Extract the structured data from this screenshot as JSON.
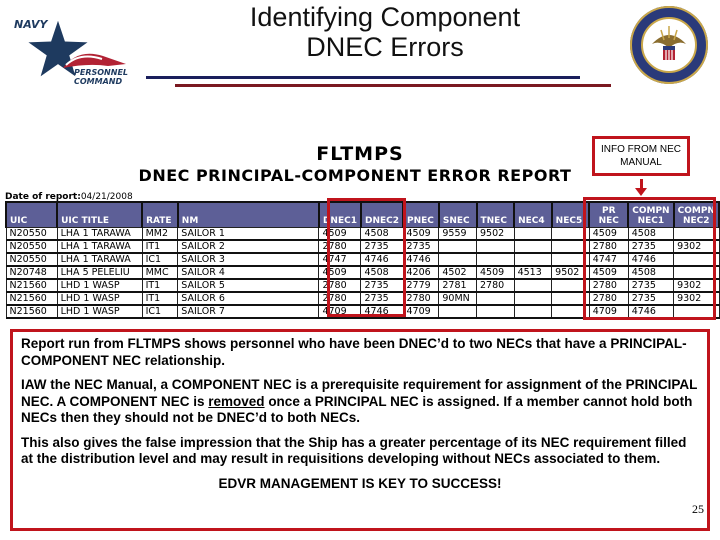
{
  "header": {
    "title_line1": "Identifying Component",
    "title_line2": "DNEC Errors",
    "left_logo": {
      "icon": "navy-personnel-command-logo-icon",
      "text_line1": "NAVY",
      "text_line2": "PERSONNEL",
      "text_line3": "COMMAND"
    },
    "right_logo": {
      "icon": "us-navy-seal-icon"
    }
  },
  "report": {
    "system": "FLTMPS",
    "title": "DNEC PRINCIPAL-COMPONENT ERROR REPORT",
    "date_label": "Date of report:",
    "date_value": "04/21/2008"
  },
  "callout": {
    "line1": "INFO FROM NEC",
    "line2": "MANUAL"
  },
  "table": {
    "columns": [
      "UIC",
      "UIC  TITLE",
      "RATE",
      "NM",
      "DNEC1",
      "DNEC2",
      "PNEC",
      "SNEC",
      "TNEC",
      "NEC4",
      "NEC5",
      "PR NEC",
      "COMPN NEC1",
      "COMPN NEC2"
    ],
    "rows": [
      [
        "N20550",
        "LHA 1 TARAWA",
        "MM2",
        "SAILOR 1",
        "4509",
        "4508",
        "4509",
        "9559",
        "9502",
        "",
        "",
        "4509",
        "4508",
        ""
      ],
      [
        "N20550",
        "LHA 1 TARAWA",
        "IT1",
        "SAILOR 2",
        "2780",
        "2735",
        "2735",
        "",
        "",
        "",
        "",
        "2780",
        "2735",
        "9302"
      ],
      [
        "N20550",
        "LHA 1 TARAWA",
        "IC1",
        "SAILOR 3",
        "4747",
        "4746",
        "4746",
        "",
        "",
        "",
        "",
        "4747",
        "4746",
        ""
      ],
      [
        "N20748",
        "LHA 5 PELELIU",
        "MMC",
        "SAILOR 4",
        "4509",
        "4508",
        "4206",
        "4502",
        "4509",
        "4513",
        "9502",
        "4509",
        "4508",
        ""
      ],
      [
        "N21560",
        "LHD 1 WASP",
        "IT1",
        "SAILOR 5",
        "2780",
        "2735",
        "2779",
        "2781",
        "2780",
        "",
        "",
        "2780",
        "2735",
        "9302"
      ],
      [
        "N21560",
        "LHD 1 WASP",
        "IT1",
        "SAILOR 6",
        "2780",
        "2735",
        "2780",
        "90MN",
        "",
        "",
        "",
        "2780",
        "2735",
        "9302"
      ],
      [
        "N21560",
        "LHD 1 WASP",
        "IC1",
        "SAILOR 7",
        "4709",
        "4746",
        "4709",
        "",
        "",
        "",
        "",
        "4709",
        "4746",
        ""
      ]
    ]
  },
  "body": {
    "para1": "Report run from FLTMPS shows personnel who have been DNEC’d to two NECs that have a PRINCIPAL-COMPONENT NEC relationship.",
    "para2_a": "IAW the NEC Manual, a COMPONENT NEC is a prerequisite requirement for assignment of the PRINCIPAL NEC.  A COMPONENT NEC is ",
    "para2_underlined": "removed",
    "para2_b": " once a PRINCIPAL NEC is assigned. If a member cannot hold both NECs then they should not be DNEC’d to both NECs.",
    "para3": "This also gives the false impression that the Ship has a greater percentage of its NEC requirement filled at the distribution level and may result in requisitions developing without NECs associated to them.",
    "key_message": "EDVR MANAGEMENT IS KEY TO SUCCESS!"
  },
  "page_number": "25",
  "colors": {
    "accent_red": "#c0141c",
    "header_fill": "#5d5f97",
    "rule_blue": "#1a1f5c",
    "rule_red": "#7a1820"
  }
}
